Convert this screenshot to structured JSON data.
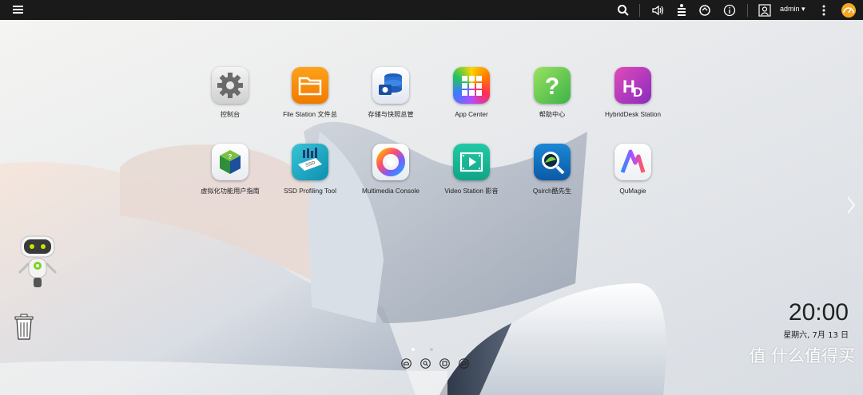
{
  "topbar": {
    "menu_icon": "hamburger-menu-icon",
    "search_icon": "search-icon",
    "volume_icon": "volume-icon",
    "tasks_icon": "background-tasks-icon",
    "sync_icon": "sync-icon",
    "info_icon": "info-icon",
    "user_icon": "user-icon",
    "username": "admin ▾",
    "more_icon": "more-vertical-icon",
    "dashboard_icon": "dashboard-gauge-icon"
  },
  "apps": [
    {
      "label": "控制台",
      "icon": "gear-icon"
    },
    {
      "label": "File Station 文件总",
      "icon": "folder-icon"
    },
    {
      "label": "存储与快照总管",
      "icon": "storage-icon"
    },
    {
      "label": "App Center",
      "icon": "app-grid-icon"
    },
    {
      "label": "帮助中心",
      "icon": "help-icon"
    },
    {
      "label": "HybridDesk Station",
      "icon": "hd-icon"
    },
    {
      "label": "虚拟化功能用户指南",
      "icon": "virtualization-guide-icon"
    },
    {
      "label": "SSD Profiling Tool",
      "icon": "ssd-icon"
    },
    {
      "label": "Multimedia Console",
      "icon": "multimedia-icon"
    },
    {
      "label": "Video Station 影音",
      "icon": "video-icon"
    },
    {
      "label": "Qsirch酷先生",
      "icon": "qsirch-icon"
    },
    {
      "label": "QuMagie",
      "icon": "qumagie-icon"
    }
  ],
  "clock": {
    "time": "20:00",
    "date": "星期六, 7月 13 日"
  },
  "watermark": "值 什么值得买",
  "colors": {
    "topbar": "#1a1a1a",
    "accent": "#f5a623"
  }
}
